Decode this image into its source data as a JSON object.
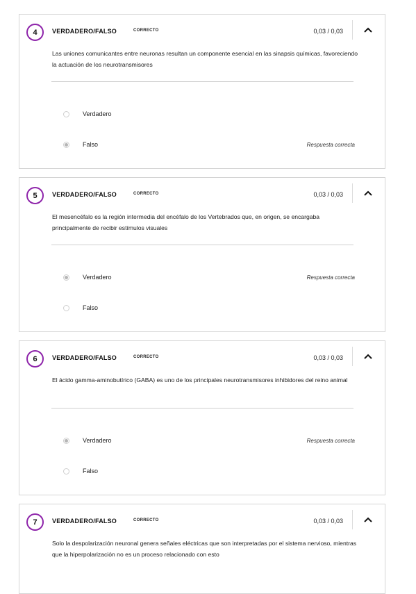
{
  "questions": [
    {
      "number": "4",
      "type": "VERDADERO/FALSO",
      "status": "CORRECTO",
      "score": "0,03 / 0,03",
      "text": "Las uniones comunicantes entre neuronas resultan un componente esencial en las sinapsis químicas, favoreciendo la actuación de los neurotransmisores",
      "options": [
        {
          "label": "Verdadero",
          "selected": false,
          "feedback": ""
        },
        {
          "label": "Falso",
          "selected": true,
          "feedback": "Respuesta correcta"
        }
      ]
    },
    {
      "number": "5",
      "type": "VERDADERO/FALSO",
      "status": "CORRECTO",
      "score": "0,03 / 0,03",
      "text": "El mesencéfalo es la región intermedia del encéfalo de los Vertebrados que, en origen, se encargaba principalmente de recibir estímulos visuales",
      "options": [
        {
          "label": "Verdadero",
          "selected": true,
          "feedback": "Respuesta correcta"
        },
        {
          "label": "Falso",
          "selected": false,
          "feedback": ""
        }
      ]
    },
    {
      "number": "6",
      "type": "VERDADERO/FALSO",
      "status": "CORRECTO",
      "score": "0,03 / 0,03",
      "text": "El ácido gamma-aminobutírico (GABA) es uno de los principales neurotransmisores inhibidores del reino animal",
      "options": [
        {
          "label": "Verdadero",
          "selected": true,
          "feedback": "Respuesta correcta"
        },
        {
          "label": "Falso",
          "selected": false,
          "feedback": ""
        }
      ]
    },
    {
      "number": "7",
      "type": "VERDADERO/FALSO",
      "status": "CORRECTO",
      "score": "0,03 / 0,03",
      "text": "Solo la despolarización neuronal genera señales eléctricas que son interpretadas por el sistema nervioso, mientras que la hiperpolarización no es un proceso relacionado con esto",
      "options": []
    }
  ],
  "icons": {
    "collapse": "chevron-up-icon",
    "radio": "radio-icon"
  },
  "colors": {
    "accent": "#8e24aa",
    "border": "#d4d4d4"
  }
}
